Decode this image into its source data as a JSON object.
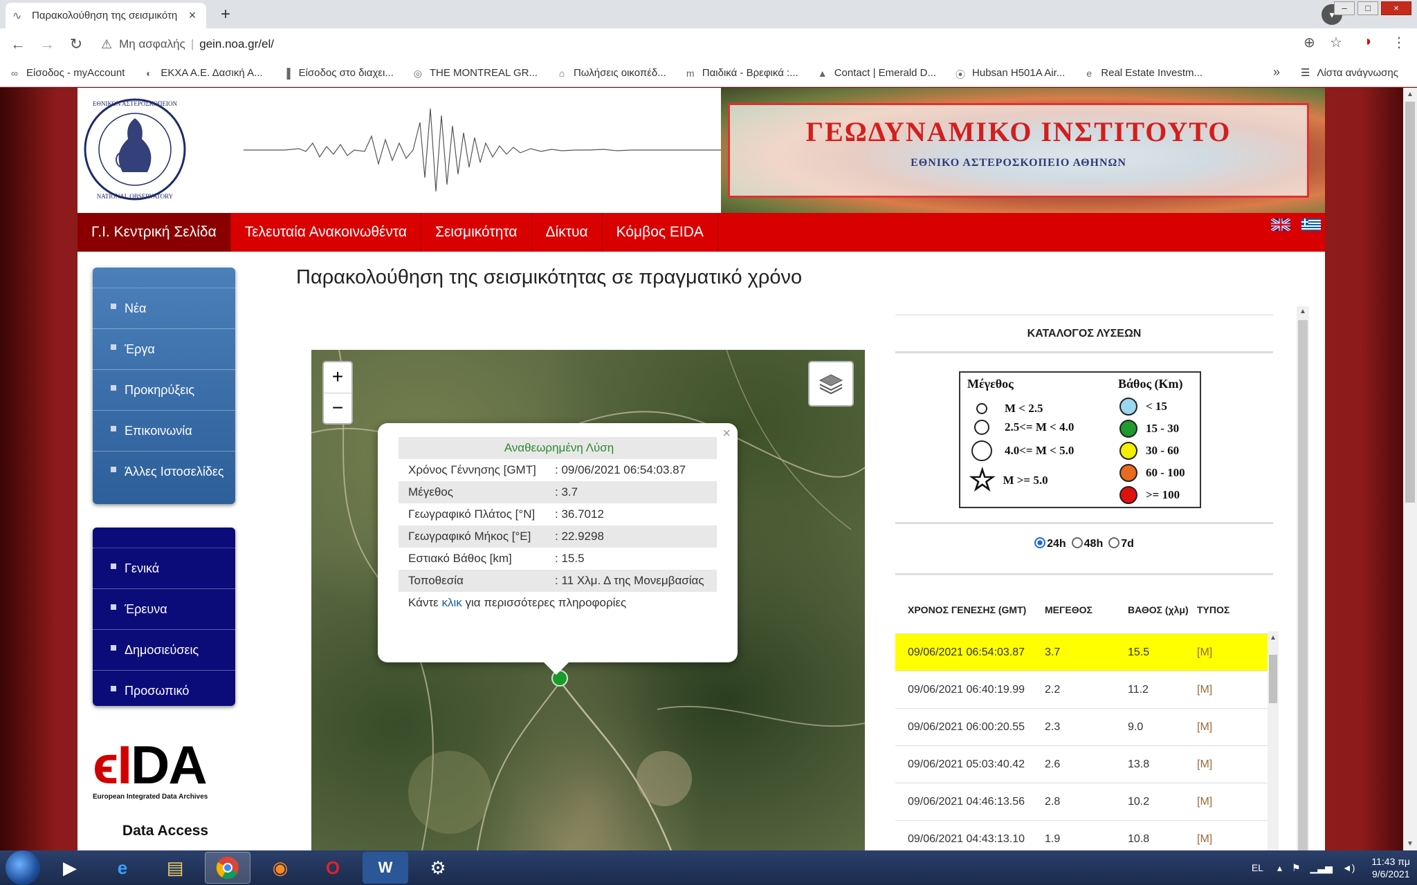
{
  "browser": {
    "tab_title": "Παρακολούθηση της σεισμικότη",
    "new_tab": "+",
    "address_security": "Μη ασφαλής",
    "address_url": "gein.noa.gr/el/",
    "bookmarks": [
      {
        "label": "Είσοδος - myAccount",
        "icon": "∞"
      },
      {
        "label": "ΕΚΧΑ Α.Ε. Δασική Α...",
        "icon": "◐"
      },
      {
        "label": "Είσοδος στο διαχει...",
        "icon": "▐"
      },
      {
        "label": "THE MONTREAL GR...",
        "icon": "◎"
      },
      {
        "label": "Πωλήσεις οικοπέδ...",
        "icon": "⌂"
      },
      {
        "label": "Παιδικά - Βρεφικά :...",
        "icon": "m"
      },
      {
        "label": "Contact | Emerald D...",
        "icon": "▲"
      },
      {
        "label": "Hubsan H501A Air...",
        "icon": "⦿"
      },
      {
        "label": "Real Estate Investm...",
        "icon": "e"
      }
    ],
    "bookmarks_more": "»",
    "reading_list": "Λίστα ανάγνωσης"
  },
  "site": {
    "banner_title": "ΓΕΩΔΥΝΑΜΙΚΟ ΙΝΣΤΙΤΟΥΤΟ",
    "banner_subtitle": "ΕΘΝΙΚΟ ΑΣΤΕΡΟΣΚΟΠΕΙΟ ΑΘΗΝΩΝ",
    "logo_text": "ΕΘΝΙΚΟΝ ΑΣΤΕΡΟΣΚΟΠΕΙΟΝ ΑΘΗΝΩΝ · NATIONAL OBSERVATORY ATHENS",
    "nav": [
      "Γ.Ι. Κεντρική Σελίδα",
      "Τελευταία Ανακοινωθέντα",
      "Σεισμικότητα",
      "Δίκτυα",
      "Κόμβος EIDA"
    ]
  },
  "sidebar": {
    "menu1": [
      "Νέα",
      "Έργα",
      "Προκηρύξεις",
      "Επικοινωνία",
      "Άλλες Ιστοσελίδες"
    ],
    "menu2": [
      "Γενικά",
      "Έρευνα",
      "Δημοσιεύσεις",
      "Προσωπικό"
    ],
    "eida_mark_red": "ϵI",
    "eida_mark_black": "DA",
    "eida_subtitle": "European Integrated Data Archives",
    "data_access": "Data Access"
  },
  "main": {
    "title": "Παρακολούθηση της σεισμικότητας σε πραγματικό χρόνο"
  },
  "map": {
    "zoom_in": "+",
    "zoom_out": "−"
  },
  "popup": {
    "title": "Αναθεωρημένη Λύση",
    "close": "×",
    "rows": [
      {
        "key": "Χρόνος Γέννησης [GMT]",
        "value": ": 09/06/2021 06:54:03.87"
      },
      {
        "key": "Μέγεθος",
        "value": ": 3.7"
      },
      {
        "key": "Γεωγραφικό Πλάτος [°N]",
        "value": ": 36.7012"
      },
      {
        "key": "Γεωγραφικό Μήκος [°E]",
        "value": ": 22.9298"
      },
      {
        "key": "Εστιακό Βάθος [km]",
        "value": ": 15.5"
      },
      {
        "key": "Τοποθεσία",
        "value": ": 11 Χλμ. Δ της Μονεμβασίας"
      }
    ],
    "more_prefix": "Κάντε ",
    "more_link": "κλικ",
    "more_suffix": " για περισσότερες πληροφορίες"
  },
  "catalog": {
    "title": "ΚΑΤΑΛΟΓΟΣ ΛΥΣΕΩΝ",
    "legend": {
      "mag_header": "Μέγεθος",
      "depth_header": "Βάθος (Km)",
      "mag_items": [
        "M < 2.5",
        "2.5<= M < 4.0",
        "4.0<= M < 5.0",
        "M >= 5.0"
      ],
      "depth_items": [
        {
          "label": "< 15",
          "color": "#9ad8f0"
        },
        {
          "label": "15 - 30",
          "color": "#1e9a2e"
        },
        {
          "label": "30 - 60",
          "color": "#f2ef00"
        },
        {
          "label": "60 - 100",
          "color": "#e86a1e"
        },
        {
          "label": ">= 100",
          "color": "#e01010"
        }
      ]
    },
    "periods": [
      "24h",
      "48h",
      "7d"
    ],
    "selected_period": "24h",
    "headers": {
      "time": "ΧΡΟΝΟΣ ΓΕΝΕΣΗΣ (GMT)",
      "mag": "ΜΕΓΕΘΟΣ",
      "depth": "ΒΑΘΟΣ (χλμ)",
      "type": "ΤΥΠΟΣ"
    },
    "events": [
      {
        "time": "09/06/2021 06:54:03.87",
        "mag": "3.7",
        "depth": "15.5",
        "type": "[M]"
      },
      {
        "time": "09/06/2021 06:40:19.99",
        "mag": "2.2",
        "depth": "11.2",
        "type": "[M]"
      },
      {
        "time": "09/06/2021 06:00:20.55",
        "mag": "2.3",
        "depth": "9.0",
        "type": "[M]"
      },
      {
        "time": "09/06/2021 05:03:40.42",
        "mag": "2.6",
        "depth": "13.8",
        "type": "[M]"
      },
      {
        "time": "09/06/2021 04:46:13.56",
        "mag": "2.8",
        "depth": "10.2",
        "type": "[M]"
      },
      {
        "time": "09/06/2021 04:43:13.10",
        "mag": "1.9",
        "depth": "10.8",
        "type": "[M]"
      }
    ]
  },
  "taskbar": {
    "lang": "EL",
    "time": "11:43 πμ",
    "date": "9/6/2021"
  }
}
